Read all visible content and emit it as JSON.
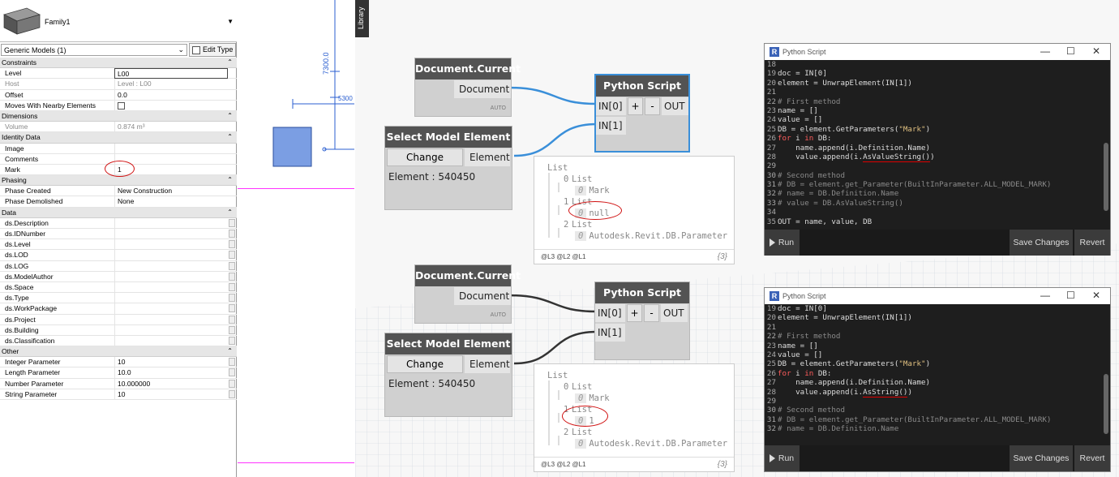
{
  "family": {
    "name": "Family1"
  },
  "type_selector": {
    "value": "Generic Models (1)",
    "edit_type": "Edit Type"
  },
  "properties": [
    {
      "kind": "group",
      "label": "Constraints"
    },
    {
      "label": "Level",
      "value": "L00",
      "box": true
    },
    {
      "label": "Host",
      "value": "Level : L00",
      "grey": true
    },
    {
      "label": "Offset",
      "value": "0.0"
    },
    {
      "label": "Moves With Nearby Elements",
      "check": true
    },
    {
      "kind": "group",
      "label": "Dimensions"
    },
    {
      "label": "Volume",
      "value": "0.874 m³",
      "grey": true
    },
    {
      "kind": "group",
      "label": "Identity Data"
    },
    {
      "label": "Image",
      "value": ""
    },
    {
      "label": "Comments",
      "value": ""
    },
    {
      "label": "Mark",
      "value": "1"
    },
    {
      "kind": "group",
      "label": "Phasing"
    },
    {
      "label": "Phase Created",
      "value": "New Construction"
    },
    {
      "label": "Phase Demolished",
      "value": "None"
    },
    {
      "kind": "group",
      "label": "Data"
    },
    {
      "label": "ds.Description",
      "value": "",
      "sb": true
    },
    {
      "label": "ds.IDNumber",
      "value": "",
      "sb": true
    },
    {
      "label": "ds.Level",
      "value": "",
      "sb": true
    },
    {
      "label": "ds.LOD",
      "value": "",
      "sb": true
    },
    {
      "label": "ds.LOG",
      "value": "",
      "sb": true
    },
    {
      "label": "ds.ModelAuthor",
      "value": "",
      "sb": true
    },
    {
      "label": "ds.Space",
      "value": "",
      "sb": true
    },
    {
      "label": "ds.Type",
      "value": "",
      "sb": true
    },
    {
      "label": "ds.WorkPackage",
      "value": "",
      "sb": true
    },
    {
      "label": "ds.Project",
      "value": "",
      "sb": true
    },
    {
      "label": "ds.Building",
      "value": "",
      "sb": true
    },
    {
      "label": "ds.Classification",
      "value": "",
      "sb": true
    },
    {
      "kind": "group",
      "label": "Other"
    },
    {
      "label": "Integer Parameter",
      "value": "10",
      "sb": true
    },
    {
      "label": "Length Parameter",
      "value": "10.0",
      "sb": true
    },
    {
      "label": "Number Parameter",
      "value": "10.000000",
      "sb": true
    },
    {
      "label": "String Parameter",
      "value": "10",
      "sb": true
    }
  ],
  "view": {
    "dim1": "7300.0",
    "dim2": "5300"
  },
  "library_tab": "Library",
  "nodes": {
    "doc_title": "Document.Current",
    "doc_port": "Document",
    "auto": "AUTO",
    "sel_title": "Select Model Element",
    "change": "Change",
    "element_port": "Element",
    "element_value": "Element : 540450",
    "py_title": "Python Script",
    "in0": "IN[0]",
    "plus": "+",
    "minus": "-",
    "out": "OUT",
    "in1": "IN[1]"
  },
  "preview1": {
    "root": "List",
    "l0": "List",
    "i0": "0",
    "v0": "Mark",
    "l1": "List",
    "i1": "0",
    "v1": "null",
    "l2": "List",
    "i2": "0",
    "v2": "Autodesk.Revit.DB.Parameter",
    "idx0": "0",
    "idx1": "1",
    "idx2": "2",
    "levels": "@L3 @L2 @L1",
    "count": "{3}"
  },
  "preview2": {
    "root": "List",
    "l0": "List",
    "i0": "0",
    "v0": "Mark",
    "l1": "List",
    "i1": "0",
    "v1": "1",
    "l2": "List",
    "i2": "0",
    "v2": "Autodesk.Revit.DB.Parameter",
    "idx0": "0",
    "idx1": "1",
    "idx2": "2",
    "levels": "@L3 @L2 @L1",
    "count": "{3}"
  },
  "editor1": {
    "title": "Python Script",
    "lines": [
      {
        "n": "18",
        "html": ""
      },
      {
        "n": "19",
        "html": "doc = IN[0]"
      },
      {
        "n": "20",
        "html": "element = UnwrapElement(IN[1])"
      },
      {
        "n": "21",
        "html": ""
      },
      {
        "n": "22",
        "html": "<span class='cm'># First method</span>"
      },
      {
        "n": "23",
        "html": "name = []"
      },
      {
        "n": "24",
        "html": "value = []"
      },
      {
        "n": "25",
        "html": "DB = element.GetParameters(<span class='str'>\"Mark\"</span>)"
      },
      {
        "n": "26",
        "html": "<span class='kw'>for</span> i <span class='kw'>in</span> DB:"
      },
      {
        "n": "27",
        "html": "    name.append(i.Definition.Name)"
      },
      {
        "n": "28",
        "html": "    value.append(i.<span class='ul'>AsValueString()</span>)"
      },
      {
        "n": "29",
        "html": ""
      },
      {
        "n": "30",
        "html": "<span class='cm'># Second method</span>"
      },
      {
        "n": "31",
        "html": "<span class='cm'># DB = element.get_Parameter(BuiltInParameter.ALL_MODEL_MARK)</span>"
      },
      {
        "n": "32",
        "html": "<span class='cm'># name = DB.Definition.Name</span>"
      },
      {
        "n": "33",
        "html": "<span class='cm'># value = DB.AsValueString()</span>"
      },
      {
        "n": "34",
        "html": ""
      },
      {
        "n": "35",
        "html": "OUT = name, value, DB"
      }
    ],
    "run": "Run",
    "save": "Save Changes",
    "revert": "Revert"
  },
  "editor2": {
    "title": "Python Script",
    "lines": [
      {
        "n": "19",
        "html": "doc = IN[0]"
      },
      {
        "n": "20",
        "html": "element = UnwrapElement(IN[1])"
      },
      {
        "n": "21",
        "html": ""
      },
      {
        "n": "22",
        "html": "<span class='cm'># First method</span>"
      },
      {
        "n": "23",
        "html": "name = []"
      },
      {
        "n": "24",
        "html": "value = []"
      },
      {
        "n": "25",
        "html": "DB = element.GetParameters(<span class='str'>\"Mark\"</span>)"
      },
      {
        "n": "26",
        "html": "<span class='kw'>for</span> i <span class='kw'>in</span> DB:"
      },
      {
        "n": "27",
        "html": "    name.append(i.Definition.Name)"
      },
      {
        "n": "28",
        "html": "    value.append(i.<span class='ul'>AsString()</span>)"
      },
      {
        "n": "29",
        "html": ""
      },
      {
        "n": "30",
        "html": "<span class='cm'># Second method</span>"
      },
      {
        "n": "31",
        "html": "<span class='cm'># DB = element.get_Parameter(BuiltInParameter.ALL_MODEL_MARK)</span>"
      },
      {
        "n": "32",
        "html": "<span class='cm'># name = DB.Definition.Name</span>"
      }
    ],
    "run": "Run",
    "save": "Save Changes",
    "revert": "Revert"
  }
}
